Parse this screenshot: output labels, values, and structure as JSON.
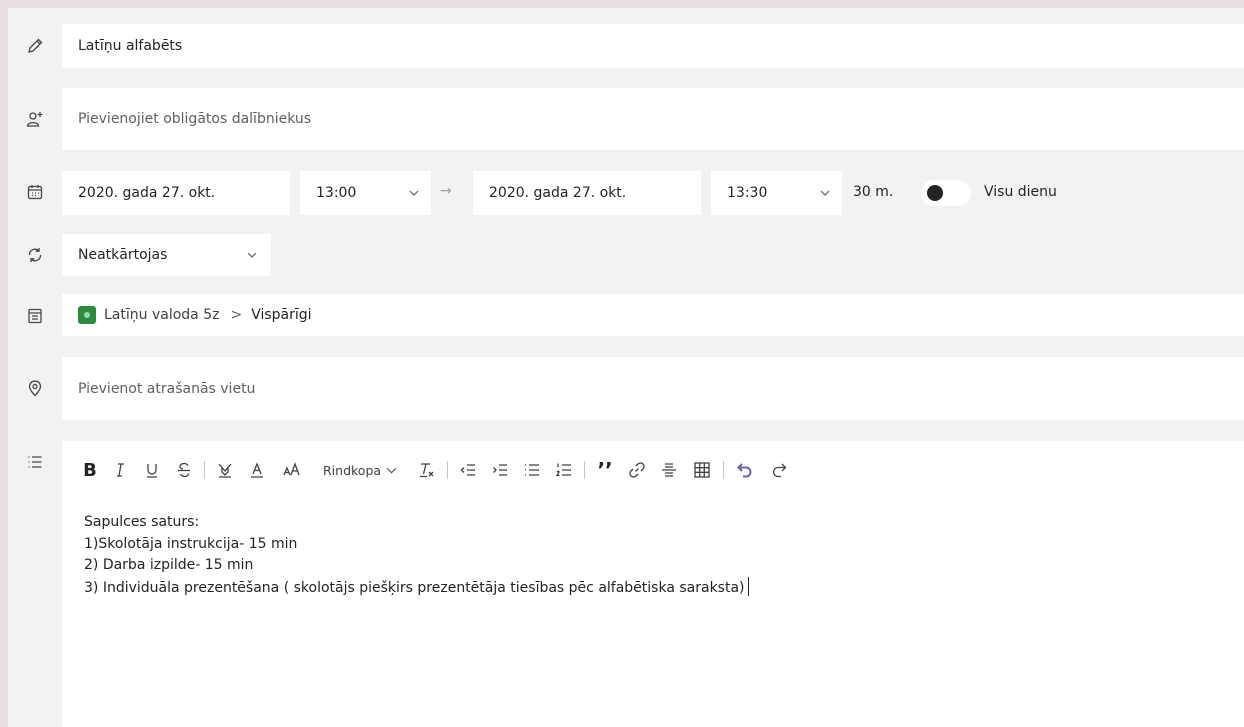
{
  "title_field": {
    "value": "Latīņu alfabēts"
  },
  "attendees_field": {
    "placeholder": "Pievienojiet obligātos dalībniekus"
  },
  "datetime": {
    "start_date": "2020. gada 27. okt.",
    "start_time": "13:00",
    "arrow": "→",
    "end_date": "2020. gada 27. okt.",
    "end_time": "13:30",
    "duration": "30 m.",
    "all_day_label": "Visu dienu",
    "all_day_on": false
  },
  "recurrence": {
    "value": "Neatkārtojas"
  },
  "channel": {
    "team": "Latīņu valoda 5z",
    "separator": ">",
    "channel": "Vispārīgi",
    "team_color": "#2e8b3e"
  },
  "location_field": {
    "placeholder": "Pievienot atrašanās vietu"
  },
  "toolbar": {
    "paragraph_label": "Rindkopa",
    "icons": [
      "bold-icon",
      "italic-icon",
      "underline-icon",
      "strikethrough-icon",
      "highlight-icon",
      "font-color-icon",
      "font-size-icon",
      "paragraph-dropdown",
      "clear-format-icon",
      "decrease-indent-icon",
      "increase-indent-icon",
      "bulleted-list-icon",
      "numbered-list-icon",
      "quote-icon",
      "link-icon",
      "horizontal-rule-icon",
      "table-icon",
      "undo-icon",
      "redo-icon"
    ]
  },
  "body": {
    "lines": [
      "Sapulces saturs:",
      "1)Skolotāja instrukcija- 15 min",
      "2) Darba izpilde- 15 min",
      "3) Individuāla prezentēšana ( skolotājs piešķirs prezentētāja tiesības pēc alfabētiska saraksta)"
    ]
  },
  "colors": {
    "accent": "#6264a7",
    "background": "#f3f2f1",
    "field": "#ffffff",
    "outer": "#e9dfe0"
  }
}
